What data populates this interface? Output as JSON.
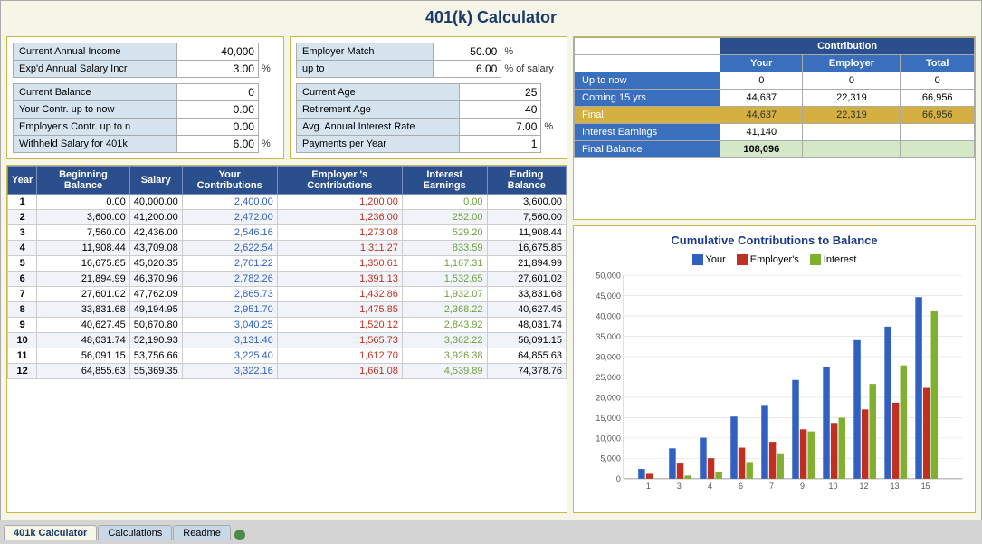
{
  "title": "401(k) Calculator",
  "inputs": {
    "current_annual_income_label": "Current Annual Income",
    "current_annual_income_value": "40,000",
    "expd_salary_label": "Exp'd Annual Salary Incr",
    "expd_salary_value": "3.00",
    "expd_salary_unit": "%",
    "current_balance_label": "Current Balance",
    "current_balance_value": "0",
    "your_contr_label": "Your Contr. up to now",
    "your_contr_value": "0.00",
    "employer_contr_label": "Employer's Contr. up to n",
    "employer_contr_value": "0.00",
    "withheld_salary_label": "Withheld Salary for 401k",
    "withheld_salary_value": "6.00",
    "withheld_salary_unit": "%"
  },
  "employer_match": {
    "label": "Employer Match",
    "value": "50.00",
    "unit": "%",
    "up_to_label": "up to",
    "up_to_value": "6.00",
    "pct_label": "% of salary"
  },
  "other_inputs": {
    "current_age_label": "Current Age",
    "current_age_value": "25",
    "retirement_age_label": "Retirement Age",
    "retirement_age_value": "40",
    "avg_interest_label": "Avg. Annual Interest Rate",
    "avg_interest_value": "7.00",
    "avg_interest_unit": "%",
    "payments_label": "Payments per Year",
    "payments_value": "1"
  },
  "contribution_table": {
    "header": "Contribution",
    "col_your": "Your",
    "col_employer": "Employer",
    "col_total": "Total",
    "rows": [
      {
        "label": "Up to now",
        "your": "0",
        "employer": "0",
        "total": "0"
      },
      {
        "label": "Coming 15 yrs",
        "your": "44,637",
        "employer": "22,319",
        "total": "66,956"
      },
      {
        "label": "Final",
        "your": "44,637",
        "employer": "22,319",
        "total": "66,956"
      },
      {
        "label": "Interest Earnings",
        "your": "41,140",
        "employer": "",
        "total": ""
      },
      {
        "label": "Final Balance",
        "your": "108,096",
        "employer": "",
        "total": ""
      }
    ]
  },
  "data_table": {
    "headers": [
      "Year",
      "Beginning Balance",
      "Salary",
      "Your Contributions",
      "Employer 's Contributions",
      "Interest Earnings",
      "Ending Balance"
    ],
    "rows": [
      {
        "year": "1",
        "begin": "0.00",
        "salary": "40,000.00",
        "your": "2,400.00",
        "emp": "1,200.00",
        "interest": "0.00",
        "end": "3,600.00"
      },
      {
        "year": "2",
        "begin": "3,600.00",
        "salary": "41,200.00",
        "your": "2,472.00",
        "emp": "1,236.00",
        "interest": "252.00",
        "end": "7,560.00"
      },
      {
        "year": "3",
        "begin": "7,560.00",
        "salary": "42,436.00",
        "your": "2,546.16",
        "emp": "1,273.08",
        "interest": "529.20",
        "end": "11,908.44"
      },
      {
        "year": "4",
        "begin": "11,908.44",
        "salary": "43,709.08",
        "your": "2,622.54",
        "emp": "1,311.27",
        "interest": "833.59",
        "end": "16,675.85"
      },
      {
        "year": "5",
        "begin": "16,675.85",
        "salary": "45,020.35",
        "your": "2,701.22",
        "emp": "1,350.61",
        "interest": "1,167.31",
        "end": "21,894.99"
      },
      {
        "year": "6",
        "begin": "21,894.99",
        "salary": "46,370.96",
        "your": "2,782.26",
        "emp": "1,391.13",
        "interest": "1,532.65",
        "end": "27,601.02"
      },
      {
        "year": "7",
        "begin": "27,601.02",
        "salary": "47,762.09",
        "your": "2,865.73",
        "emp": "1,432.86",
        "interest": "1,932.07",
        "end": "33,831.68"
      },
      {
        "year": "8",
        "begin": "33,831.68",
        "salary": "49,194.95",
        "your": "2,951.70",
        "emp": "1,475.85",
        "interest": "2,368.22",
        "end": "40,627.45"
      },
      {
        "year": "9",
        "begin": "40,627.45",
        "salary": "50,670.80",
        "your": "3,040.25",
        "emp": "1,520.12",
        "interest": "2,843.92",
        "end": "48,031.74"
      },
      {
        "year": "10",
        "begin": "48,031.74",
        "salary": "52,190.93",
        "your": "3,131.46",
        "emp": "1,565.73",
        "interest": "3,362.22",
        "end": "56,091.15"
      },
      {
        "year": "11",
        "begin": "56,091.15",
        "salary": "53,756.66",
        "your": "3,225.40",
        "emp": "1,612.70",
        "interest": "3,926.38",
        "end": "64,855.63"
      },
      {
        "year": "12",
        "begin": "64,855.63",
        "salary": "55,369.35",
        "your": "3,322.16",
        "emp": "1,661.08",
        "interest": "4,539.89",
        "end": "74,378.76"
      }
    ]
  },
  "chart": {
    "title": "Cumulative Contributions to Balance",
    "legend": [
      "Your",
      "Employer's",
      "Interest"
    ],
    "legend_colors": [
      "#3060c0",
      "#c03020",
      "#80b030"
    ],
    "y_labels": [
      "50,000",
      "45,000",
      "40,000",
      "35,000",
      "30,000",
      "25,000",
      "20,000",
      "15,000",
      "10,000",
      "5,000",
      "0"
    ],
    "x_labels": [
      "1",
      "3",
      "4",
      "6",
      "7",
      "9",
      "10",
      "12",
      "13",
      "15"
    ],
    "bars": [
      {
        "x": 1,
        "your": 2400,
        "emp": 1200,
        "int": 0
      },
      {
        "x": 3,
        "your": 7464,
        "emp": 3732,
        "int": 781
      },
      {
        "x": 4,
        "your": 10086,
        "emp": 5043,
        "int": 1614
      },
      {
        "x": 6,
        "your": 15268,
        "emp": 7634,
        "int": 4100
      },
      {
        "x": 7,
        "your": 18134,
        "emp": 9067,
        "int": 6032
      },
      {
        "x": 9,
        "your": 24275,
        "emp": 12137,
        "int": 11620
      },
      {
        "x": 10,
        "your": 27406,
        "emp": 13703,
        "int": 14982
      },
      {
        "x": 12,
        "your": 34050,
        "emp": 17025,
        "int": 23304
      },
      {
        "x": 13,
        "your": 37372,
        "emp": 18686,
        "int": 27844
      },
      {
        "x": 15,
        "your": 44637,
        "emp": 22319,
        "int": 41140
      }
    ],
    "max_val": 50000
  },
  "tabs": [
    {
      "label": "401k Calculator",
      "active": true
    },
    {
      "label": "Calculations",
      "active": false
    },
    {
      "label": "Readme",
      "active": false
    }
  ]
}
